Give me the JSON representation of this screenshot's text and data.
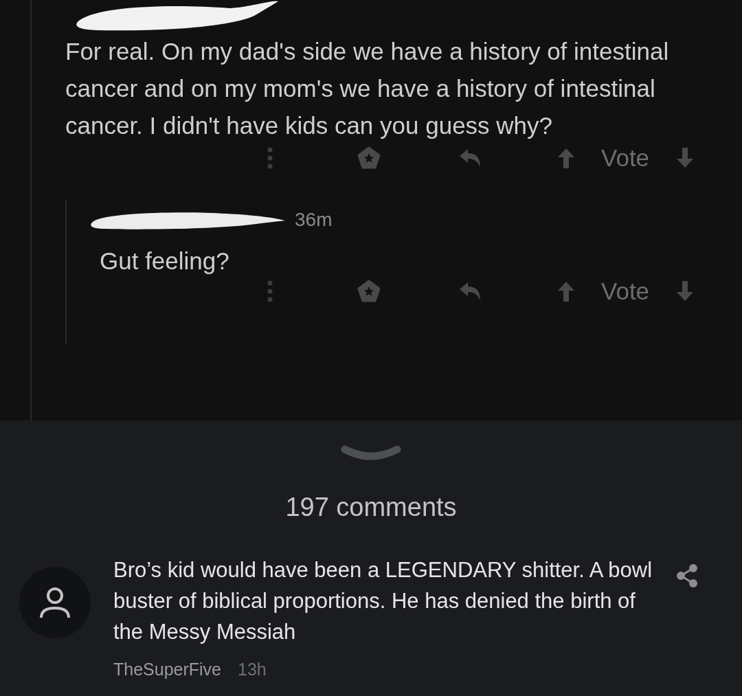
{
  "parent_comment": {
    "text": "For real. On my dad's side we have a history of intestinal cancer and on my mom's we have a history of intestinal cancer. I didn't have kids can you guess why?",
    "vote_label": "Vote"
  },
  "reply": {
    "time": "36m",
    "text": "Gut feeling?",
    "vote_label": "Vote"
  },
  "comments_count": "197 comments",
  "comment": {
    "text": "Bro’s kid would have been a LEGENDARY shitter. A bowl buster of biblical proportions. He has denied the birth of the Messy Messiah",
    "author": "TheSuperFive",
    "time": "13h"
  }
}
